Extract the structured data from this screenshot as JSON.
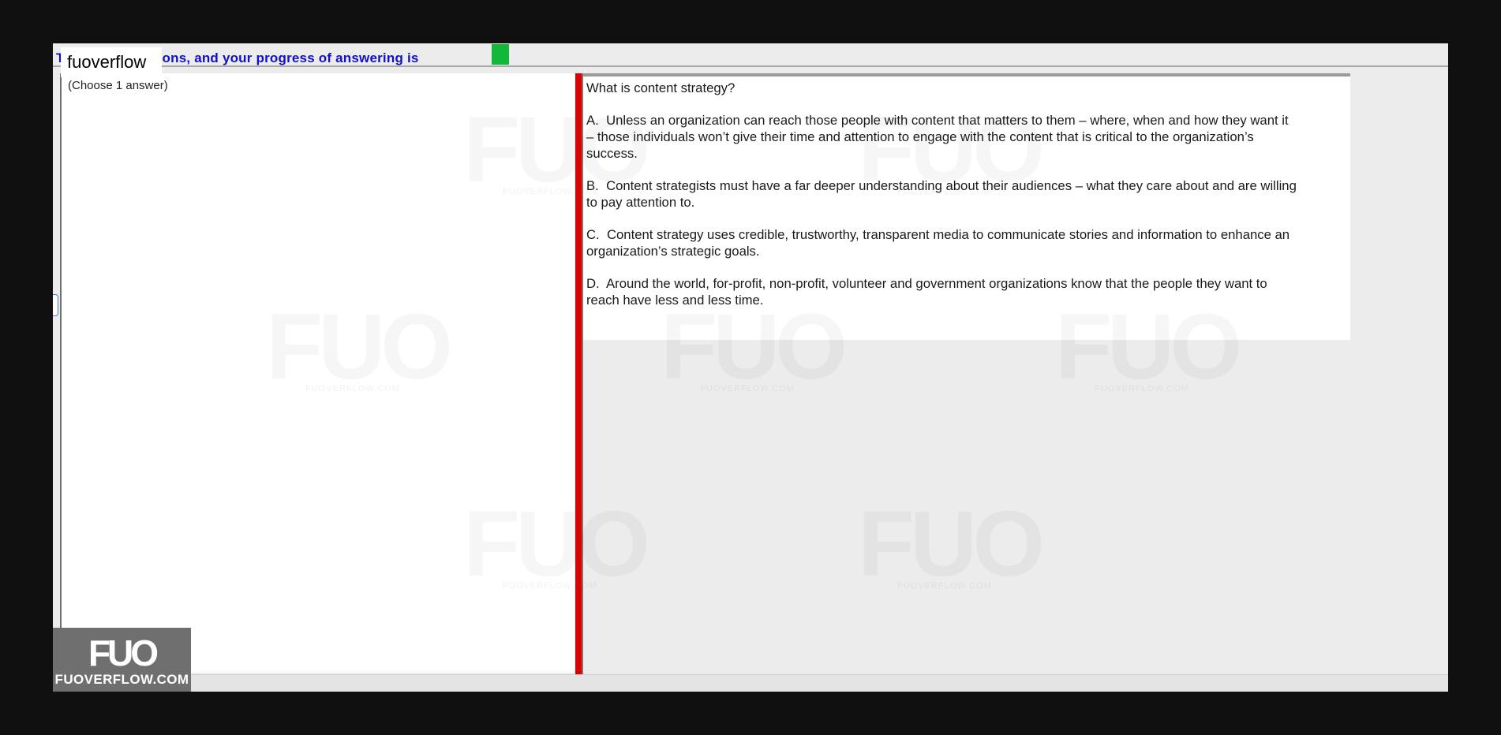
{
  "header": {
    "progress_text": "There are questions, and your progress of answering is",
    "progress_color": "#12b83a",
    "site_label": "fuoverflow"
  },
  "left_panel": {
    "instruction": "(Choose 1 answer)"
  },
  "question": {
    "title": "What is content strategy?",
    "options": [
      {
        "letter": "A.",
        "text": "Unless an organization can reach those people with content that matters to them – where, when and how they want it – those individuals won’t give their time and attention to engage with the content that is critical to the organization’s success."
      },
      {
        "letter": "B.",
        "text": "Content strategists must have a far deeper understanding about their audiences – what they care about and are willing to pay attention to."
      },
      {
        "letter": "C.",
        "text": "Content strategy uses credible, trustworthy, transparent media to communicate stories and information to enhance an organization’s strategic goals."
      },
      {
        "letter": "D.",
        "text": "Around the world, for-profit, non-profit, volunteer and government organizations know that the people they want to reach have less and less time."
      }
    ]
  },
  "watermark": {
    "mark": "FUO",
    "text": "FUOVERFLOW.COM"
  },
  "logo": {
    "mark": "FUO",
    "text": "FUOVERFLOW.COM"
  },
  "colors": {
    "splitter": "#e00000",
    "progress_text": "#1010c8"
  }
}
